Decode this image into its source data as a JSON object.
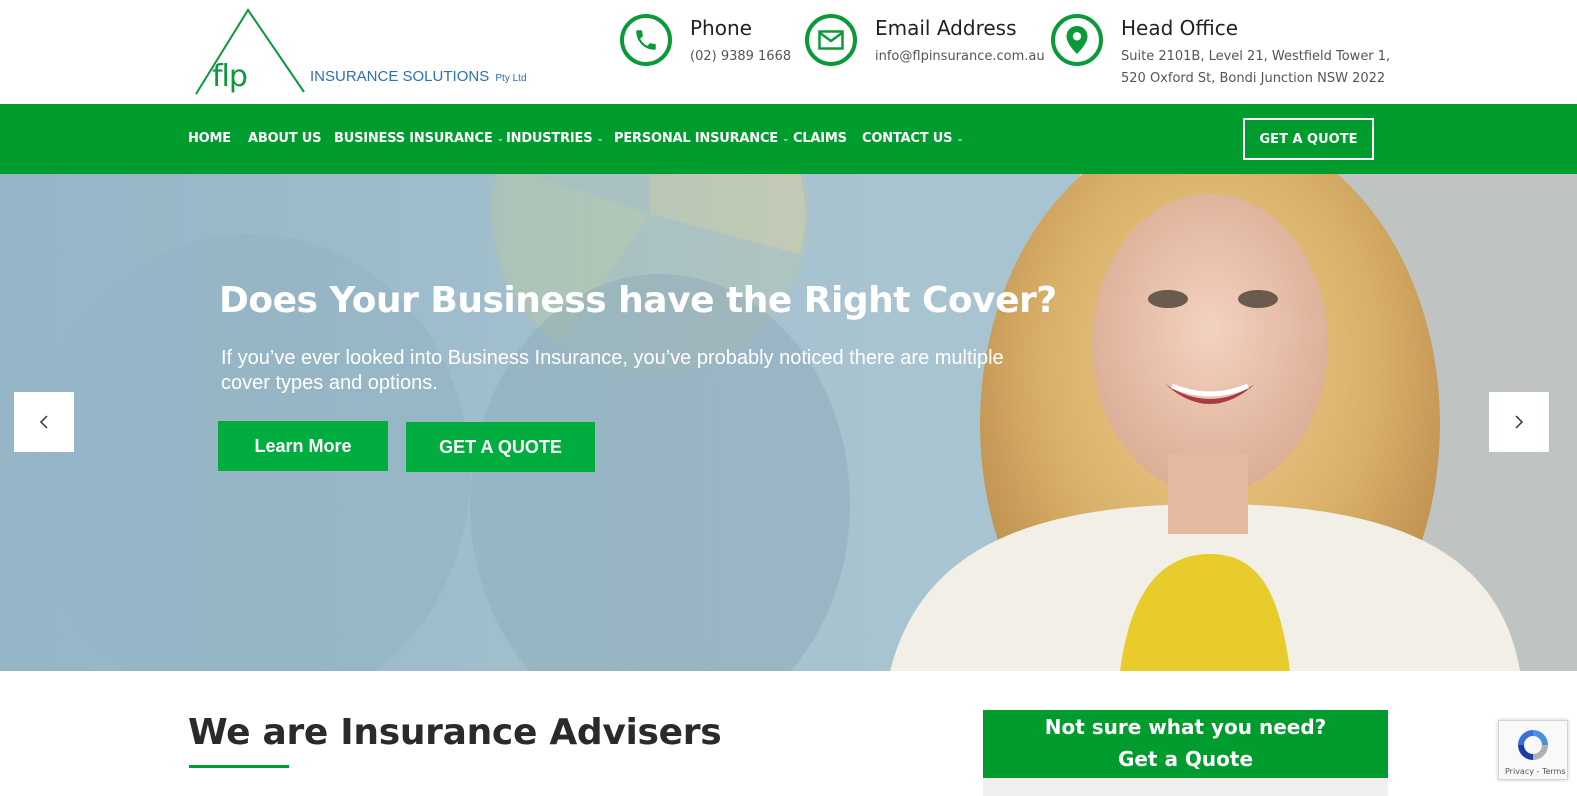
{
  "header": {
    "logo": {
      "mark": "flp",
      "name": "INSURANCE SOLUTIONS",
      "suffix": "Pty Ltd"
    },
    "contacts": [
      {
        "label": "Phone",
        "lines": [
          "(02) 9389 1668"
        ],
        "icon": "phone-icon"
      },
      {
        "label": "Email Address",
        "lines": [
          "info@flpinsurance.com.au"
        ],
        "icon": "email-icon"
      },
      {
        "label": "Head Office",
        "lines": [
          "Suite 2101B, Level 21, Westfield Tower 1,",
          "520 Oxford St, Bondi Junction NSW 2022"
        ],
        "icon": "location-pin-icon"
      }
    ]
  },
  "nav": {
    "items": [
      {
        "label": "HOME",
        "dropdown": false
      },
      {
        "label": "ABOUT US",
        "dropdown": false
      },
      {
        "label": "BUSINESS INSURANCE",
        "dropdown": true
      },
      {
        "label": "INDUSTRIES",
        "dropdown": true
      },
      {
        "label": "PERSONAL INSURANCE",
        "dropdown": true
      },
      {
        "label": "CLAIMS",
        "dropdown": false
      },
      {
        "label": "CONTACT US",
        "dropdown": true
      }
    ],
    "cta": "GET A QUOTE"
  },
  "hero": {
    "title": "Does Your Business have the Right Cover?",
    "subtitle": "If you’ve ever looked into Business Insurance, you’ve probably noticed there are multiple cover types and options.",
    "primary_button": "Learn More",
    "secondary_button": "GET A QUOTE"
  },
  "about": {
    "title": "We are Insurance Advisers"
  },
  "quote_box": {
    "line1": "Not sure what you need?",
    "line2": "Get a Quote"
  },
  "recaptcha": {
    "text": "Privacy - Terms"
  },
  "colors": {
    "brand_green": "#009c2e",
    "button_green": "#00ad3e",
    "logo_blue": "#2a6fb7"
  }
}
